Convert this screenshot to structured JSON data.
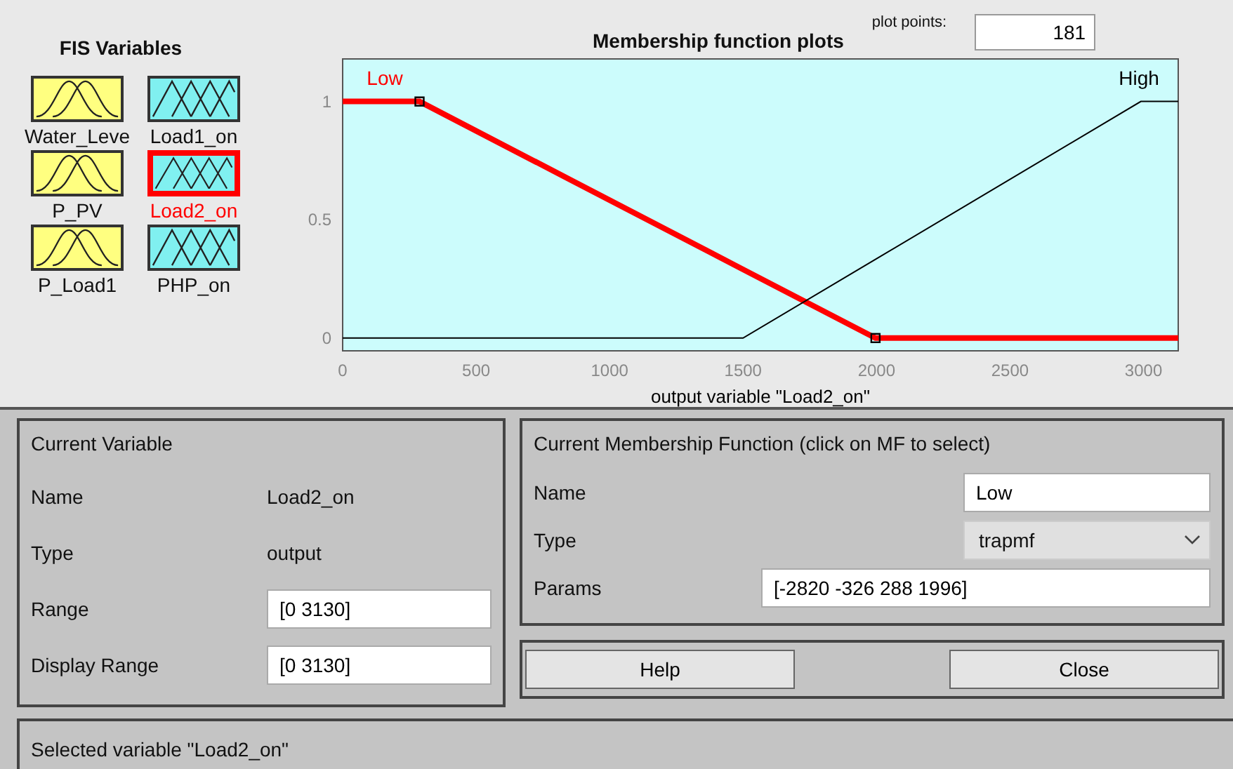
{
  "fis_variables": {
    "title": "FIS Variables",
    "items": [
      {
        "label": "Water_Leve",
        "kind": "input",
        "selected": false
      },
      {
        "label": "Load1_on",
        "kind": "output",
        "selected": false
      },
      {
        "label": "P_PV",
        "kind": "input",
        "selected": false
      },
      {
        "label": "Load2_on",
        "kind": "output",
        "selected": true
      },
      {
        "label": "P_Load1",
        "kind": "input",
        "selected": false
      },
      {
        "label": "PHP_on",
        "kind": "output",
        "selected": false
      }
    ]
  },
  "plot": {
    "plot_points_label": "plot points:",
    "plot_points": "181",
    "chart_data": {
      "type": "line",
      "title": "Membership function plots",
      "xlabel": "output variable \"Load2_on\"",
      "x": [
        0,
        288,
        1500,
        1996,
        2990,
        3130
      ],
      "xlim": [
        0,
        3130
      ],
      "ylim": [
        -0.054,
        1.18
      ],
      "xticks": [
        0,
        500,
        1000,
        1500,
        2000,
        2500,
        3000
      ],
      "yticks": [
        0,
        {
          "value": 0.5,
          "label": "0.5"
        },
        1
      ],
      "series": [
        {
          "name": "Low",
          "color": "#ff0000",
          "values": [
            1,
            1,
            0.29,
            0,
            0,
            0
          ]
        },
        {
          "name": "High",
          "color": "#000000",
          "values": [
            0,
            0,
            0,
            0.333,
            1,
            1
          ]
        }
      ]
    },
    "curves": [
      {
        "selected": true
      },
      {
        "selected": false
      }
    ]
  },
  "current_variable": {
    "title": "Current Variable",
    "rows": [
      {
        "label": "Name",
        "value": "Load2_on",
        "kind": "text"
      },
      {
        "label": "Type",
        "value": "output",
        "kind": "text"
      },
      {
        "label": "Range",
        "value": "[0 3130]",
        "kind": "field"
      },
      {
        "label": "Display Range",
        "value": "[0 3130]",
        "kind": "field"
      }
    ]
  },
  "current_mf": {
    "title": "Current Membership Function (click on MF to select)",
    "name_label": "Name",
    "name_value": "Low",
    "type_label": "Type",
    "type_value": "trapmf",
    "params_label": "Params",
    "params_value": "[-2820 -326 288 1996]"
  },
  "buttons": [
    "Help",
    "Close"
  ],
  "status_bar": "Selected variable \"Load2_on\""
}
